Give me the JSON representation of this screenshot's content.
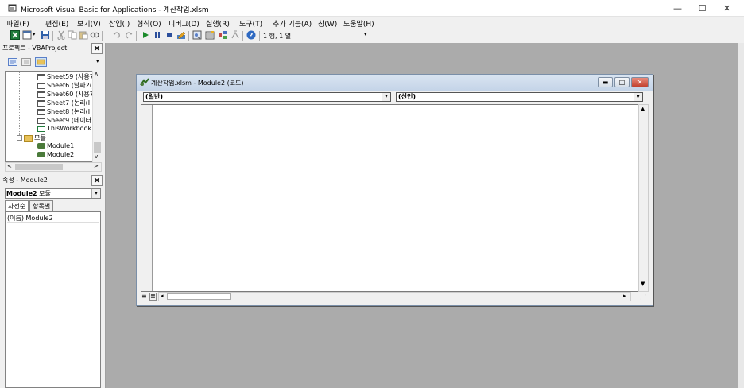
{
  "window": {
    "title": "Microsoft Visual Basic for Applications - 계산작업.xlsm",
    "controls": {
      "minimize": "—",
      "maximize": "☐",
      "close": "✕"
    }
  },
  "menubar": {
    "items": [
      "파일(F)",
      "편집(E)",
      "보기(V)",
      "삽입(I)",
      "형식(O)",
      "디버그(D)",
      "실행(R)",
      "도구(T)",
      "추가 기능(A)",
      "창(W)",
      "도움말(H)"
    ]
  },
  "toolbar": {
    "position_text": "1 행, 1 열",
    "icons": [
      "excel-icon",
      "insert-module-icon",
      "save-icon",
      "cut-icon",
      "copy-icon",
      "paste-icon",
      "find-icon",
      "undo-icon",
      "redo-icon",
      "run-icon",
      "break-icon",
      "reset-icon",
      "design-mode-icon",
      "project-explorer-icon",
      "properties-icon",
      "object-browser-icon",
      "toolbox-icon",
      "help-icon"
    ]
  },
  "project_pane": {
    "title": "프로젝트 - VBAProject",
    "tree": [
      {
        "label": "Sheet59 (사용7",
        "type": "sheet",
        "indent": 1
      },
      {
        "label": "Sheet6 (날짜2(",
        "type": "sheet",
        "indent": 1
      },
      {
        "label": "Sheet60 (사용7",
        "type": "sheet",
        "indent": 1
      },
      {
        "label": "Sheet7 (논리(I",
        "type": "sheet",
        "indent": 1
      },
      {
        "label": "Sheet8 (논리(I",
        "type": "sheet",
        "indent": 1
      },
      {
        "label": "Sheet9 (데이터",
        "type": "sheet",
        "indent": 1
      },
      {
        "label": "ThisWorkbook",
        "type": "workbook",
        "indent": 1
      },
      {
        "label": "모듈",
        "type": "folder",
        "indent": 0
      },
      {
        "label": "Module1",
        "type": "module",
        "indent": 1
      },
      {
        "label": "Module2",
        "type": "module",
        "indent": 1
      }
    ]
  },
  "properties_pane": {
    "title": "속성 - Module2",
    "object_name": "Module2",
    "object_type": "모듈",
    "tabs": [
      "사전순",
      "항목별"
    ],
    "rows": [
      {
        "name": "(이름)",
        "value": "Module2"
      }
    ]
  },
  "code_window": {
    "title": "계산작업.xlsm - Module2 (코드)",
    "object_combo": "(일반)",
    "procedure_combo": "(선언)",
    "content": ""
  }
}
